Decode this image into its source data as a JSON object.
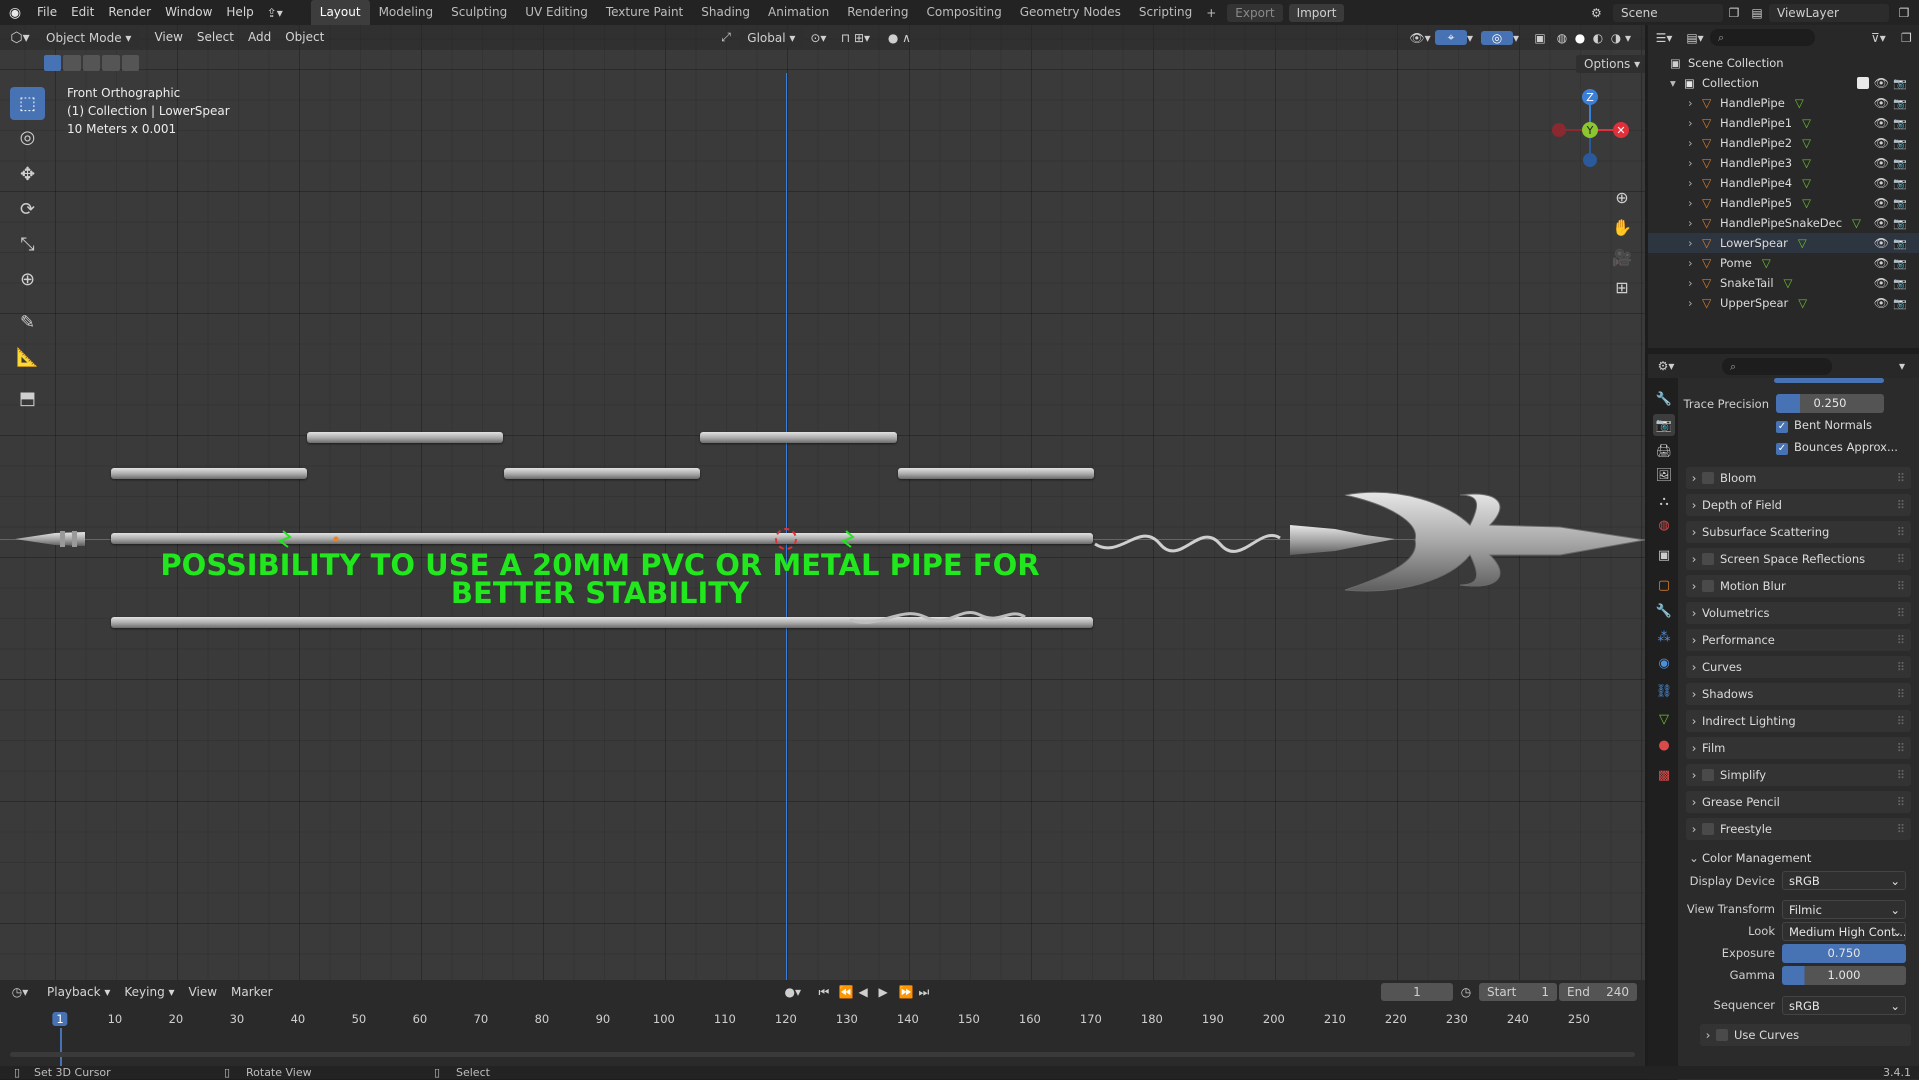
{
  "menu": {
    "items": [
      "File",
      "Edit",
      "Render",
      "Window",
      "Help"
    ],
    "workspaces": [
      "Layout",
      "Modeling",
      "Sculpting",
      "UV Editing",
      "Texture Paint",
      "Shading",
      "Animation",
      "Rendering",
      "Compositing",
      "Geometry Nodes",
      "Scripting"
    ],
    "active_workspace": "Layout",
    "export_label": "Export",
    "import_label": "Import",
    "scene_name": "Scene",
    "view_layer": "ViewLayer"
  },
  "viewport": {
    "mode": "Object Mode",
    "menus": [
      "View",
      "Select",
      "Add",
      "Object"
    ],
    "transform_orientation": "Global",
    "options_label": "Options",
    "info_line1": "Front Orthographic",
    "info_line2": "(1) Collection | LowerSpear",
    "info_line3": "10 Meters x 0.001",
    "annotation_line1": "POSSIBILITY TO USE A 20MM PVC OR METAL PIPE FOR",
    "annotation_line2": "BETTER STABILITY",
    "annotation_color": "#22e61e",
    "gizmo": {
      "z": "Z",
      "y": "Y"
    }
  },
  "outliner": {
    "scene_collection": "Scene Collection",
    "collection": "Collection",
    "objects": [
      "HandlePipe",
      "HandlePipe1",
      "HandlePipe2",
      "HandlePipe3",
      "HandlePipe4",
      "HandlePipe5",
      "HandlePipeSnakeDec",
      "LowerSpear",
      "Pome",
      "SnakeTail",
      "UpperSpear"
    ],
    "selected": "LowerSpear"
  },
  "properties": {
    "trace_precision_label": "Trace Precision",
    "trace_precision_value": "0.250",
    "bent_normals": "Bent Normals",
    "bounces_approx": "Bounces Approx...",
    "panels": [
      "Bloom",
      "Depth of Field",
      "Subsurface Scattering",
      "Screen Space Reflections",
      "Motion Blur",
      "Volumetrics",
      "Performance",
      "Curves",
      "Shadows",
      "Indirect Lighting",
      "Film",
      "Simplify",
      "Grease Pencil",
      "Freestyle"
    ],
    "panels_with_checkbox": [
      "Bloom",
      "Screen Space Reflections",
      "Motion Blur",
      "Simplify",
      "Freestyle"
    ],
    "color_management": {
      "title": "Color Management",
      "display_device_label": "Display Device",
      "display_device": "sRGB",
      "view_transform_label": "View Transform",
      "view_transform": "Filmic",
      "look_label": "Look",
      "look": "Medium High Cont...",
      "exposure_label": "Exposure",
      "exposure": "0.750",
      "gamma_label": "Gamma",
      "gamma": "1.000",
      "sequencer_label": "Sequencer",
      "sequencer": "sRGB",
      "use_curves": "Use Curves"
    }
  },
  "timeline": {
    "menus": [
      "Playback",
      "Keying",
      "View",
      "Marker"
    ],
    "current_frame": "1",
    "start_label": "Start",
    "start": "1",
    "end_label": "End",
    "end": "240",
    "ticks": [
      "1",
      "10",
      "20",
      "30",
      "40",
      "50",
      "60",
      "70",
      "80",
      "90",
      "100",
      "110",
      "120",
      "130",
      "140",
      "150",
      "160",
      "170",
      "180",
      "190",
      "200",
      "210",
      "220",
      "230",
      "240",
      "250"
    ]
  },
  "status": {
    "left": "Set 3D Cursor",
    "middle": "Rotate View",
    "right": "Select",
    "version": "3.4.1"
  },
  "colors": {
    "accent": "#4772b3",
    "object_orange": "#d97b2a",
    "axis_red": "#e0303a",
    "axis_green": "#8bc530",
    "axis_blue": "#3c7fd8"
  }
}
